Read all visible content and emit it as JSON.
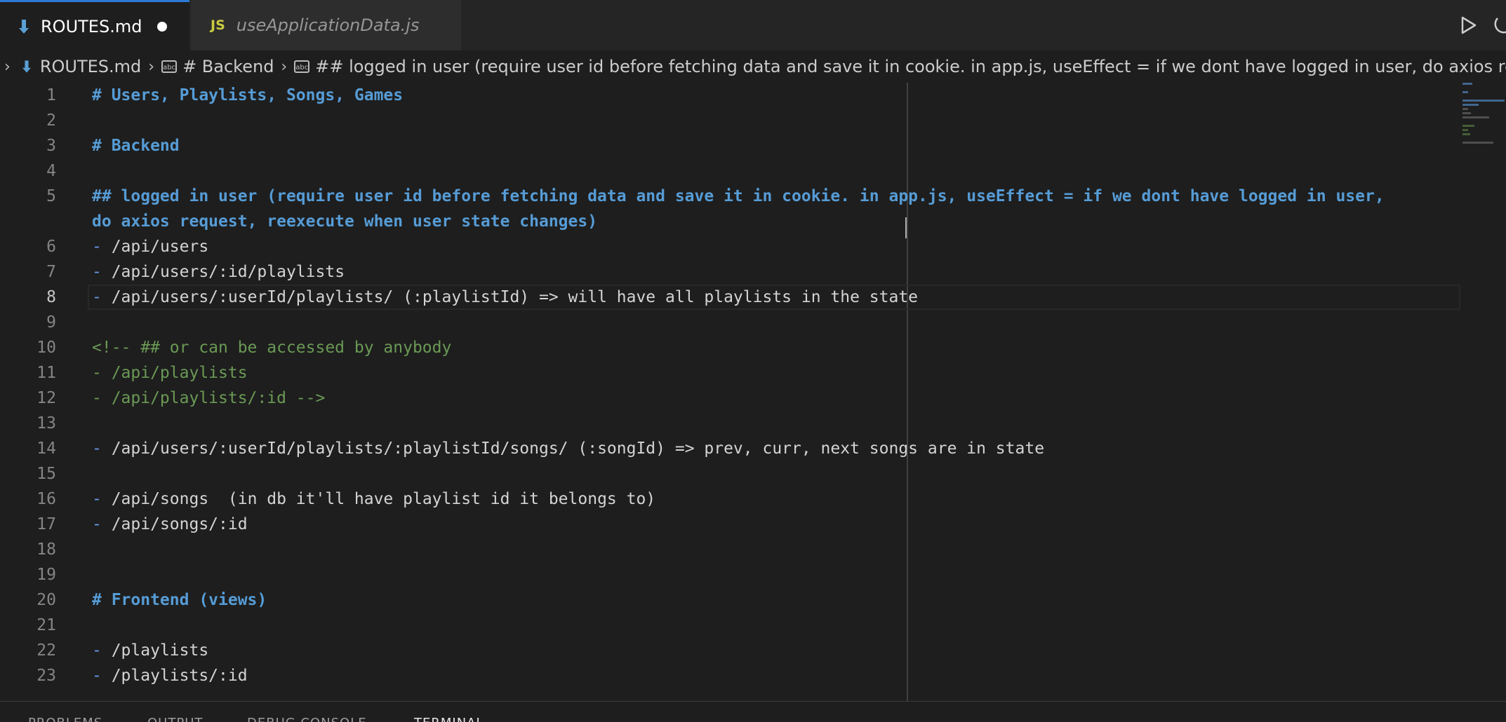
{
  "tabs": [
    {
      "label": "ROUTES.md",
      "active": true,
      "dirty": true
    },
    {
      "label": "useApplicationData.js",
      "active": false,
      "icon": "JS"
    }
  ],
  "breadcrumb": {
    "file": "ROUTES.md",
    "items": [
      "# Backend",
      "## logged in user (require user id before fetching data and save it in cookie. in app.js, useEffect = if we dont have logged in user, do axios request, reexecute when user state changes)"
    ]
  },
  "editor": {
    "current_line": "8",
    "lines": [
      {
        "n": "1",
        "text": "# Users, Playlists, Songs, Games"
      },
      {
        "n": "2",
        "text": ""
      },
      {
        "n": "3",
        "text": "# Backend"
      },
      {
        "n": "4",
        "text": ""
      },
      {
        "n": "5",
        "text": "## logged in user (require user id before fetching data and save it in cookie. in app.js, useEffect = if we dont have logged in user,"
      },
      {
        "n": "",
        "text": "do axios request, reexecute when user state changes)"
      },
      {
        "n": "6",
        "dash": "-",
        "text": " /api/users"
      },
      {
        "n": "7",
        "dash": "-",
        "text": " /api/users/:id/playlists"
      },
      {
        "n": "8",
        "dash": "-",
        "text": " /api/users/:userId/playlists/ (:playlistId) => will have all playlists in the state"
      },
      {
        "n": "9",
        "text": ""
      },
      {
        "n": "10",
        "text": "<!-- ## or can be accessed by anybody"
      },
      {
        "n": "11",
        "text": "- /api/playlists"
      },
      {
        "n": "12",
        "text": "- /api/playlists/:id -->"
      },
      {
        "n": "13",
        "text": ""
      },
      {
        "n": "14",
        "dash": "-",
        "text": " /api/users/:userId/playlists/:playlistId/songs/ (:songId) => prev, curr, next songs are in state"
      },
      {
        "n": "15",
        "text": ""
      },
      {
        "n": "16",
        "dash": "-",
        "text": " /api/songs  (in db it'll have playlist id it belongs to)"
      },
      {
        "n": "17",
        "dash": "-",
        "text": " /api/songs/:id"
      },
      {
        "n": "18",
        "text": ""
      },
      {
        "n": "19",
        "text": ""
      },
      {
        "n": "20",
        "text": "# Frontend (views)"
      },
      {
        "n": "21",
        "text": ""
      },
      {
        "n": "22",
        "dash": "-",
        "text": " /playlists"
      },
      {
        "n": "23",
        "dash": "-",
        "text": " /playlists/:id"
      }
    ]
  },
  "panel": {
    "tabs": [
      "PROBLEMS",
      "OUTPUT",
      "DEBUG CONSOLE",
      "TERMINAL"
    ],
    "active": "TERMINAL"
  },
  "colors": {
    "accent": "#2c7ad6",
    "heading": "#569cd6",
    "comment": "#6a9955",
    "background": "#1e1e1e"
  }
}
